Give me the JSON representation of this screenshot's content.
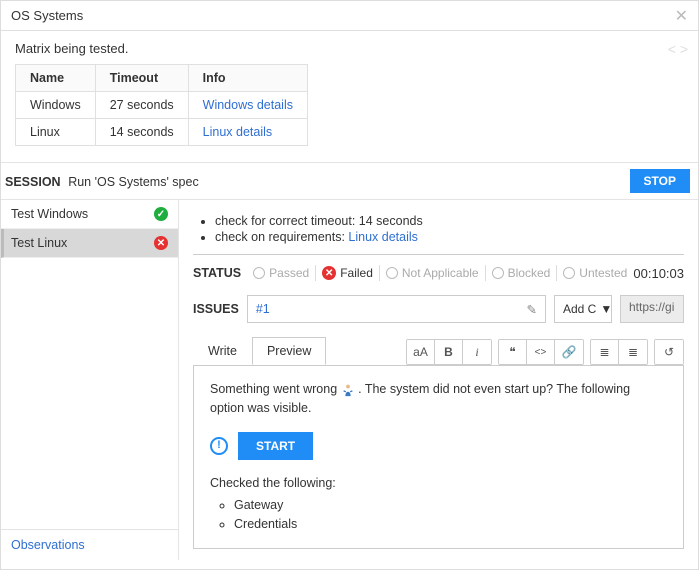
{
  "title": "OS Systems",
  "matrix": {
    "description": "Matrix being tested.",
    "headers": [
      "Name",
      "Timeout",
      "Info"
    ],
    "rows": [
      {
        "name": "Windows",
        "timeout": "27 seconds",
        "info": "Windows details"
      },
      {
        "name": "Linux",
        "timeout": "14 seconds",
        "info": "Linux details"
      }
    ]
  },
  "session": {
    "label": "SESSION",
    "description": "Run 'OS Systems' spec",
    "stop_label": "STOP"
  },
  "tests": [
    {
      "label": "Test Windows",
      "status": "pass"
    },
    {
      "label": "Test Linux",
      "status": "fail"
    }
  ],
  "observations_label": "Observations",
  "detail": {
    "checks": [
      "check for correct timeout: 14 seconds",
      "check on requirements: "
    ],
    "check_link": "Linux details",
    "status": {
      "label": "STATUS",
      "options": [
        "Passed",
        "Failed",
        "Not Applicable",
        "Blocked",
        "Untested"
      ],
      "selected": "Failed",
      "timer": "00:10:03"
    },
    "issues": {
      "label": "ISSUES",
      "value": "#1",
      "dropdown": "Add C",
      "url": "https://gi"
    },
    "tabs": {
      "write": "Write",
      "preview": "Preview"
    },
    "toolbar": {
      "case": "aA",
      "bold": "B",
      "italic": "i",
      "quote": "❝",
      "code": "<>",
      "link": "🔗",
      "ul": "≣",
      "ol": "≣",
      "undo": "↺"
    },
    "preview": {
      "text1_before": "Something went wrong ",
      "text1_after": ". The system did not even start up? The following option was visible.",
      "start_label": "START",
      "text2": "Checked the following:",
      "items": [
        "Gateway",
        "Credentials"
      ]
    }
  }
}
